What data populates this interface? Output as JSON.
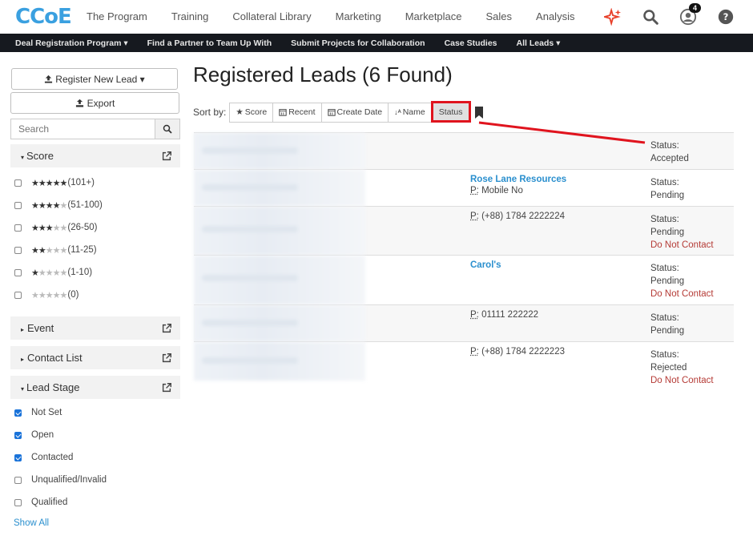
{
  "nav": {
    "logo_text": "CCoE",
    "links": [
      "The Program",
      "Training",
      "Collateral Library",
      "Marketing",
      "Marketplace",
      "Sales",
      "Analysis"
    ],
    "notification_count": "4",
    "colors": {
      "accent": "#3aa0e0",
      "sparkle": "#e8402a",
      "subnav_bg": "#16191f"
    }
  },
  "subnav": {
    "items": [
      "Deal Registration Program ▾",
      "Find a Partner to Team Up With",
      "Submit Projects for Collaboration",
      "Case Studies",
      "All Leads ▾"
    ]
  },
  "sidebar": {
    "register_label": "Register New Lead ▾",
    "export_label": "Export",
    "search_placeholder": "Search",
    "score_title": "Score",
    "score_options": [
      {
        "filled": 5,
        "label": "(101+)"
      },
      {
        "filled": 4,
        "label": "(51-100)"
      },
      {
        "filled": 3,
        "label": "(26-50)"
      },
      {
        "filled": 2,
        "label": "(11-25)"
      },
      {
        "filled": 1,
        "label": "(1-10)"
      },
      {
        "filled": 0,
        "label": "(0)"
      }
    ],
    "event_title": "Event",
    "contact_list_title": "Contact List",
    "lead_stage_title": "Lead Stage",
    "lead_stages": [
      {
        "label": "Not Set",
        "checked": true
      },
      {
        "label": "Open",
        "checked": true
      },
      {
        "label": "Contacted",
        "checked": true
      },
      {
        "label": "Unqualified/Invalid",
        "checked": false
      },
      {
        "label": "Qualified",
        "checked": false
      }
    ],
    "show_all": "Show All"
  },
  "main": {
    "title": "Registered Leads  (6 Found)",
    "sort_label": "Sort by:",
    "sort_options": [
      {
        "icon": "star-icon",
        "label": "Score"
      },
      {
        "icon": "calendar-icon",
        "label": "Recent"
      },
      {
        "icon": "calendar-icon",
        "label": "Create Date"
      },
      {
        "icon": "sort-alpha-icon",
        "label": "Name"
      },
      {
        "icon": "",
        "label": "Status",
        "active": true
      }
    ],
    "leads": [
      {
        "company": "",
        "phone_label": "",
        "phone": "",
        "status_label": "Status:",
        "status": "Accepted",
        "dnc": ""
      },
      {
        "company": "Rose Lane Resources",
        "phone_label": "P:",
        "phone": " Mobile No",
        "status_label": "Status:",
        "status": "Pending",
        "dnc": ""
      },
      {
        "company": "",
        "phone_label": "P:",
        "phone": " (+88) 1784 2222224",
        "status_label": "Status:",
        "status": "Pending",
        "dnc": "Do Not Contact"
      },
      {
        "company": "Carol's",
        "phone_label": "",
        "phone": "",
        "status_label": "Status:",
        "status": "Pending",
        "dnc": "Do Not Contact"
      },
      {
        "company": "",
        "phone_label": "P:",
        "phone": " 01111 222222",
        "status_label": "Status:",
        "status": "Pending",
        "dnc": ""
      },
      {
        "company": "",
        "phone_label": "P:",
        "phone": " (+88) 1784 2222223",
        "status_label": "Status:",
        "status": "Rejected",
        "dnc": "Do Not Contact"
      }
    ]
  }
}
